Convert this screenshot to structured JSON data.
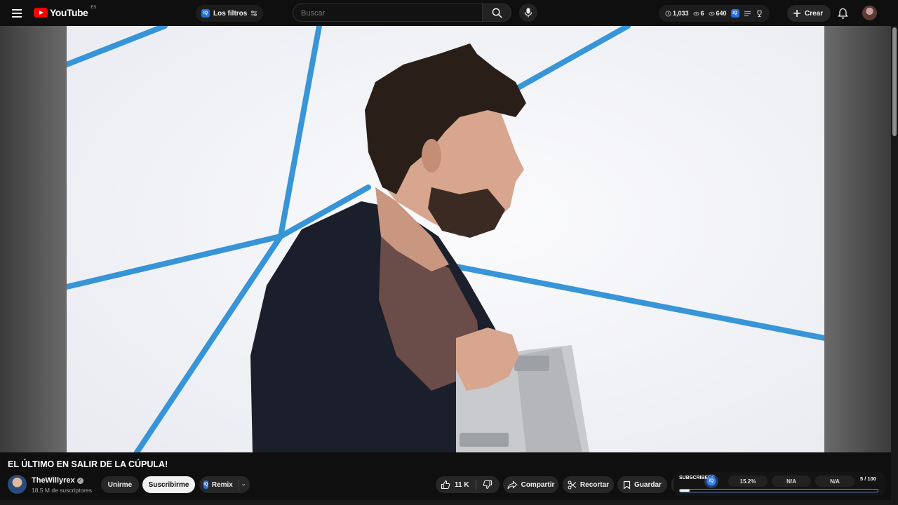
{
  "topbar": {
    "logo_text": "YouTube",
    "logo_country": "ES",
    "filters_label": "Los filtros",
    "filters_badge": "IQ",
    "search_placeholder": "Buscar",
    "stats": {
      "views": "1,033",
      "stat2": "6",
      "stat3": "640",
      "badge": "IQ"
    },
    "create_label": "Crear"
  },
  "video": {
    "title": "EL ÚLTIMO EN SALIR DE LA CÚPULA!"
  },
  "channel": {
    "name": "TheWillyrex",
    "verified_mark": "✓",
    "subscribers": "18,5 M de suscriptores"
  },
  "actions": {
    "join_label": "Unirme",
    "subscribe_label": "Suscribirme",
    "remix_label": "Remix",
    "remix_badge": "IQ",
    "likes": "11 K",
    "share_label": "Compartir",
    "clip_label": "Recortar",
    "save_label": "Guardar"
  },
  "subscriber_widget": {
    "title": "SUBSCRIBERS",
    "percent": "15.2%",
    "na_1": "N/A",
    "na_2": "N/A",
    "count": "5 / 100",
    "knob_badge": "IQ",
    "progress": 0.05
  },
  "colors": {
    "brand_red": "#ff0000",
    "accent_blue": "#3b82f6",
    "background": "#0f0f0f"
  }
}
